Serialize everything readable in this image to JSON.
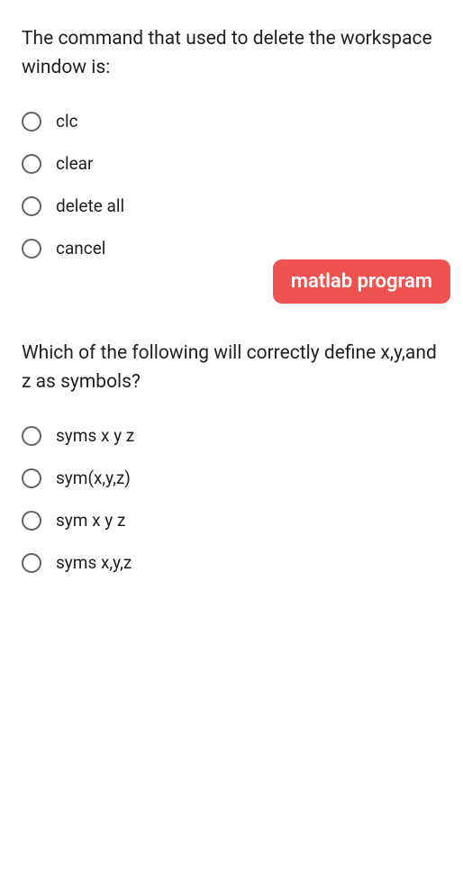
{
  "question1": {
    "text": "The command that used to delete the workspace window is:",
    "options": [
      "clc",
      "clear",
      "delete all",
      "cancel"
    ]
  },
  "badge": {
    "text": "matlab program"
  },
  "question2": {
    "text": "Which of the following will correctly define x,y,and z as symbols?",
    "options": [
      "syms x y z",
      "sym(x,y,z)",
      "sym x y z",
      "syms x,y,z"
    ]
  }
}
